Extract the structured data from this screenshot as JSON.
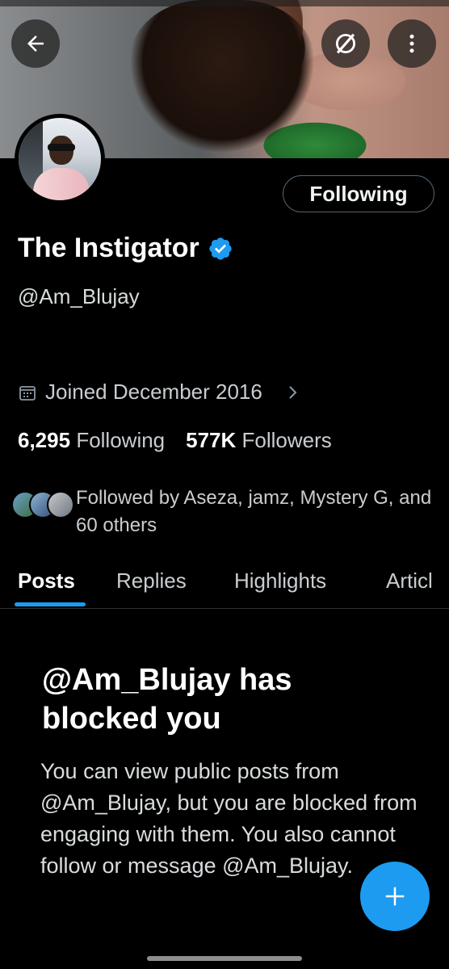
{
  "header": {
    "back_icon": "arrow-left-icon",
    "grok_icon": "slashed-circle-icon",
    "more_icon": "vertical-dots-icon"
  },
  "profile": {
    "display_name": "The Instigator",
    "verified": true,
    "handle": "@Am_Blujay",
    "follow_button_label": "Following",
    "joined": "Joined December 2016",
    "following_count": "6,295",
    "following_label": "Following",
    "followers_count": "577K",
    "followers_label": "Followers",
    "followed_by": "Followed by Aseza, jamz, Mystery G, and 60 others"
  },
  "tabs": [
    {
      "label": "Posts",
      "active": true
    },
    {
      "label": "Replies",
      "active": false
    },
    {
      "label": "Highlights",
      "active": false
    },
    {
      "label": "Articl",
      "active": false
    }
  ],
  "blocked": {
    "title": "@Am_Blujay has blocked you",
    "body": "You can view public posts from @Am_Blujay, but you are blocked from engaging with them. You also cannot follow or message @Am_Blujay."
  },
  "fab": {
    "icon": "plus-icon"
  },
  "colors": {
    "accent": "#1d9bf0",
    "background": "#000000"
  }
}
